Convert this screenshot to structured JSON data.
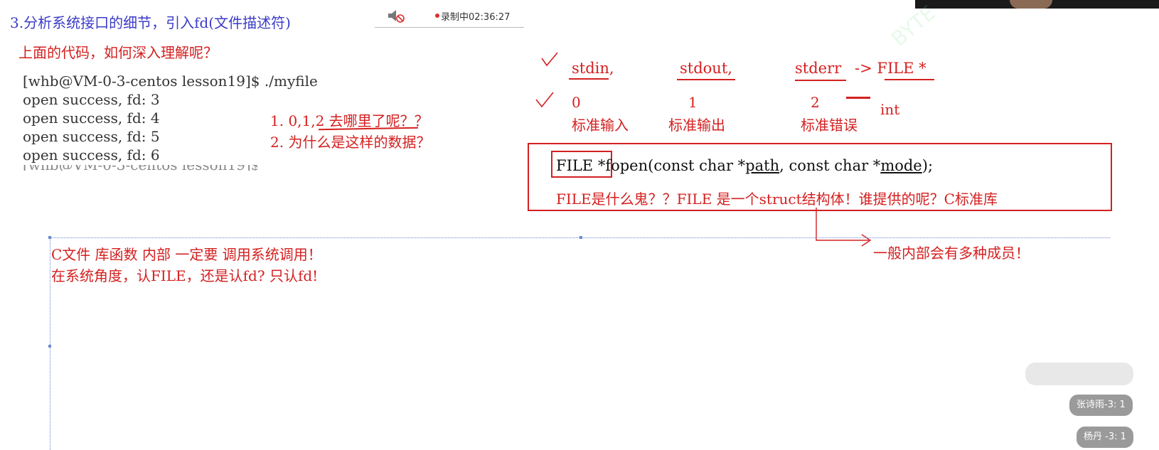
{
  "title": "3.分析系统接口的细节，引入fd(文件描述符)",
  "recording": {
    "label": "录制中02:36:27"
  },
  "question": "上面的代码，如何深入理解呢？",
  "terminal": {
    "command": "[whb@VM-0-3-centos lesson19]$ ./myfile",
    "lines": [
      "open success, fd: 3",
      "open success, fd: 4",
      "open success, fd: 5",
      "open success, fd: 6"
    ],
    "truncated_line": "[whb@VM-0-3-centos lesson19]$"
  },
  "questions": [
    "1. 0,1,2 去哪里了呢？？",
    "2. 为什么是这样的数据？"
  ],
  "std_streams": {
    "names": [
      "stdin,",
      "stdout,",
      "stderr"
    ],
    "arrow_type": "-> FILE *",
    "fds": [
      "0",
      "1",
      "2"
    ],
    "fd_type": "int",
    "labels": [
      "标准输入",
      "标准输出",
      "标准错误"
    ]
  },
  "fopen": {
    "sig_prefix": "FILE *fopen(const char *",
    "sig_path": "path",
    "sig_mid": ", const char *",
    "sig_mode": "mode",
    "sig_end": ");",
    "note": "FILE是什么鬼？？FILE 是一个struct结构体！谁提供的呢？C标准库"
  },
  "members_note": "一般内部会有多种成员！",
  "notes": [
    "C文件 库函数 内部 一定要 调用系统调用！",
    "在系统角度，认FILE，还是认fd? 只认fd!"
  ],
  "chat": {
    "messages": [
      "张诗雨-3: 1",
      "杨丹 -3: 1"
    ]
  },
  "colors": {
    "blue_text": "#3b3bc8",
    "red_ink": "#d42020",
    "box": "#d42020"
  }
}
